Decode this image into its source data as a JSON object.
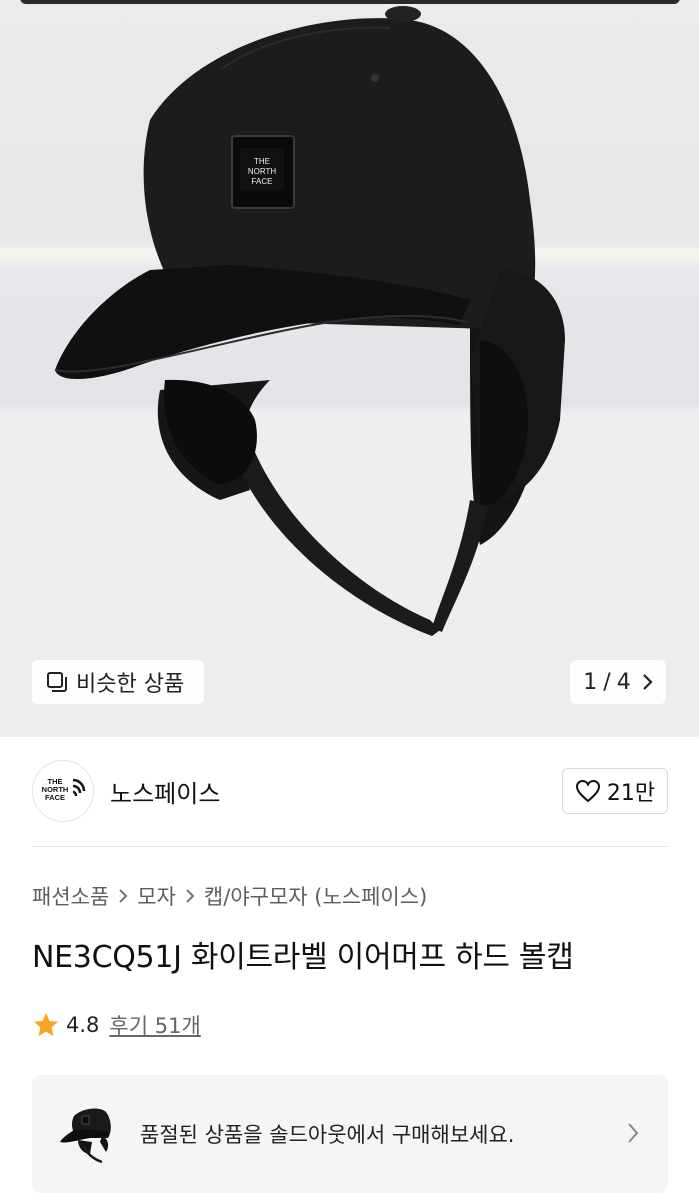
{
  "product_image": {
    "logo_text": [
      "THE",
      "NORTH",
      "FACE"
    ],
    "similar_button": {
      "label": "비슷한 상품",
      "icon": "similar-squares-icon"
    },
    "pager": {
      "current": "1",
      "separator": "/",
      "total": "4",
      "icon": "chevron-right-icon"
    }
  },
  "store": {
    "logo_text": [
      "THE",
      "NORTH",
      "FACE"
    ],
    "name": "노스페이스",
    "likes": {
      "count": "21만",
      "icon": "heart-icon"
    }
  },
  "breadcrumb": {
    "items": [
      "패션소품",
      "모자",
      "캡/야구모자 (노스페이스)"
    ],
    "separator_icon": "chevron-right-icon"
  },
  "product": {
    "title": "NE3CQ51J 화이트라벨 이어머프 하드 볼캡",
    "rating": {
      "score": "4.8",
      "reviews_label": "후기 51개",
      "icon": "star-icon",
      "star_color": "#f5a623"
    }
  },
  "soldout_banner": {
    "text": "품절된 상품을 솔드아웃에서 구매해보세요.",
    "icon": "chevron-right-icon"
  }
}
